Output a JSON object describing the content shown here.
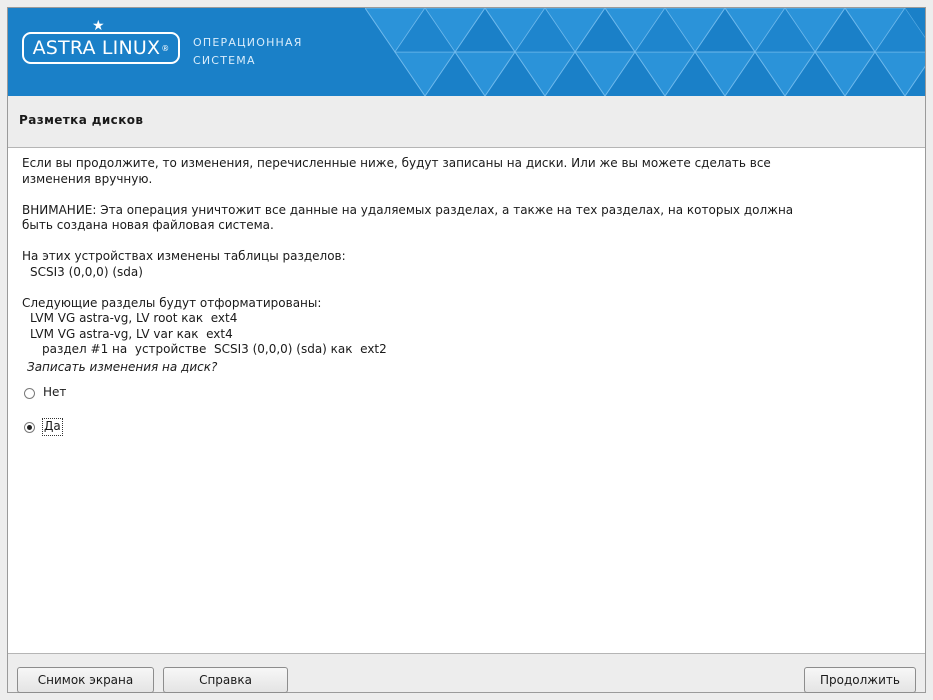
{
  "brand": {
    "logo_text": "ASTRA LINUX",
    "logo_mark": "®",
    "star_icon": "star-icon",
    "tagline_line1": "ОПЕРАЦИОННАЯ",
    "tagline_line2": "СИСТЕМА",
    "banner_color": "#1a80c8"
  },
  "page": {
    "title": "Разметка дисков"
  },
  "content": {
    "intro_line1": "Если вы продолжите, то изменения, перечисленные ниже, будут записаны на диски. Или же вы можете сделать все",
    "intro_line2": "изменения вручную.",
    "warning_line1": "ВНИМАНИЕ: Эта операция уничтожит все данные на удаляемых разделах, а также на тех разделах, на которых должна",
    "warning_line2": "быть создана новая файловая система.",
    "tables_heading": "На этих устройствах изменены таблицы разделов:",
    "tables_devices": [
      "SCSI3 (0,0,0) (sda)"
    ],
    "format_heading": "Следующие разделы будут отформатированы:",
    "format_items": [
      "LVM VG astra-vg, LV root как  ext4",
      "LVM VG astra-vg, LV var как  ext4",
      "раздел #1 на  устройстве  SCSI3 (0,0,0) (sda) как  ext2"
    ],
    "question": "Записать изменения на диск?",
    "options": [
      {
        "label": "Нет",
        "selected": false
      },
      {
        "label": "Да",
        "selected": true
      }
    ]
  },
  "buttons": {
    "screenshot": "Снимок экрана",
    "help": "Справка",
    "continue": "Продолжить"
  }
}
